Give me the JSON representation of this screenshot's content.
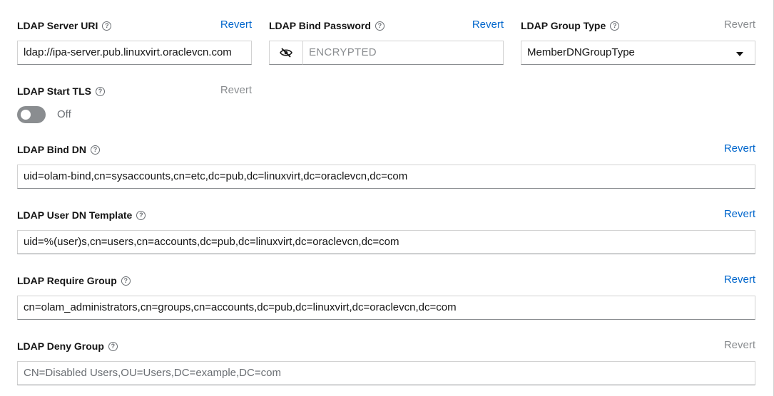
{
  "fields": {
    "server_uri": {
      "label": "LDAP Server URI",
      "revert": "Revert",
      "value": "ldap://ipa-server.pub.linuxvirt.oraclevcn.com"
    },
    "bind_password": {
      "label": "LDAP Bind Password",
      "revert": "Revert",
      "placeholder": "ENCRYPTED",
      "toggle_icon": "eye-slash-icon"
    },
    "group_type": {
      "label": "LDAP Group Type",
      "revert": "Revert",
      "value": "MemberDNGroupType"
    },
    "start_tls": {
      "label": "LDAP Start TLS",
      "revert": "Revert",
      "state": "Off"
    },
    "bind_dn": {
      "label": "LDAP Bind DN",
      "revert": "Revert",
      "value": "uid=olam-bind,cn=sysaccounts,cn=etc,dc=pub,dc=linuxvirt,dc=oraclevcn,dc=com"
    },
    "user_dn_template": {
      "label": "LDAP User DN Template",
      "revert": "Revert",
      "value": "uid=%(user)s,cn=users,cn=accounts,dc=pub,dc=linuxvirt,dc=oraclevcn,dc=com"
    },
    "require_group": {
      "label": "LDAP Require Group",
      "revert": "Revert",
      "value": "cn=olam_administrators,cn=groups,cn=accounts,dc=pub,dc=linuxvirt,dc=oraclevcn,dc=com"
    },
    "deny_group": {
      "label": "LDAP Deny Group",
      "revert": "Revert",
      "placeholder": "CN=Disabled Users,OU=Users,DC=example,DC=com"
    }
  },
  "colors": {
    "link": "#0066cc",
    "disabled": "#8a8d90",
    "border": "#d2d2d2"
  }
}
